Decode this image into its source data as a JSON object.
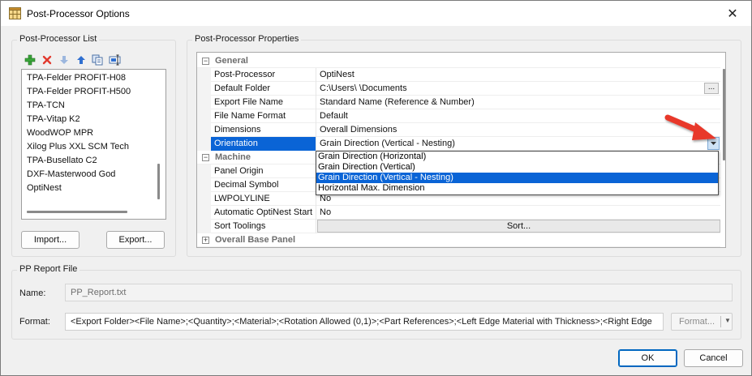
{
  "window": {
    "title": "Post-Processor Options",
    "close_glyph": "✕",
    "icon": "app-grid-icon"
  },
  "pp_list": {
    "group_label": "Post-Processor List",
    "toolbar": [
      "add-icon",
      "delete-icon",
      "move-down-icon",
      "move-up-icon",
      "copy-icon",
      "rename-icon"
    ],
    "items": [
      "TPA-Felder PROFIT-H08",
      "TPA-Felder PROFIT-H500",
      "TPA-TCN",
      "TPA-Vitap K2",
      "WoodWOP MPR",
      "Xilog Plus XXL SCM Tech",
      "TPA-Busellato C2",
      "DXF-Masterwood God",
      "OptiNest"
    ],
    "import_label": "Import...",
    "export_label": "Export..."
  },
  "properties": {
    "group_label": "Post-Processor Properties",
    "categories": {
      "general": "General",
      "machine": "Machine",
      "overall_base_panel": "Overall Base Panel"
    },
    "expander": {
      "open": "−",
      "closed": "+"
    },
    "general_rows": [
      {
        "name": "Post-Processor",
        "value": "OptiNest"
      },
      {
        "name": "Default Folder",
        "value": "C:\\Users\\          \\Documents"
      },
      {
        "name": "Export File Name",
        "value": "Standard Name (Reference & Number)"
      },
      {
        "name": "File Name Format",
        "value": "Default"
      },
      {
        "name": "Dimensions",
        "value": "Overall Dimensions"
      },
      {
        "name": "Orientation",
        "value": "Grain Direction (Vertical - Nesting)"
      }
    ],
    "machine_rows": [
      {
        "name": "Panel Origin",
        "value": ""
      },
      {
        "name": "Decimal Symbol",
        "value": ""
      },
      {
        "name": "LWPOLYLINE",
        "value": "No"
      },
      {
        "name": "Automatic OptiNest Start",
        "value": "No"
      },
      {
        "name": "Sort Toolings",
        "value": "Sort..."
      }
    ],
    "ellipsis_label": "...",
    "orientation_options": [
      "Grain Direction (Horizontal)",
      "Grain Direction (Vertical)",
      "Grain Direction (Vertical - Nesting)",
      "Horizontal Max. Dimension"
    ],
    "orientation_selected_index": 2
  },
  "report": {
    "group_label": "PP Report File",
    "name_label": "Name:",
    "name_value": "PP_Report.txt",
    "format_label": "Format:",
    "format_value": "<Export Folder><File Name>;<Quantity>;<Material>;<Rotation Allowed (0,1)>;<Part References>;<Left Edge Material with Thickness>;<Right Edge",
    "format_button_label": "Format...",
    "format_button_arrow": "▼"
  },
  "footer": {
    "ok_label": "OK",
    "cancel_label": "Cancel"
  },
  "colors": {
    "selection": "#0a64d6",
    "annotation_arrow": "#e8392b",
    "default_button_border": "#0067c0"
  }
}
